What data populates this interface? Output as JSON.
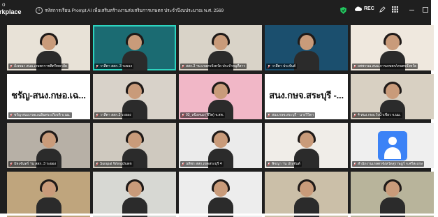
{
  "app": {
    "brand_top": "o",
    "brand_bottom": "rkplace"
  },
  "meeting": {
    "title": "รหัสการเรียน Prompt AI เพื่อเสริมสร้างงานส่งเสริมการเกษตร ประจำปีงบประมาณ พ.ศ. 2569"
  },
  "toolbar": {
    "rec_label": "REC",
    "icons": [
      "info-icon",
      "shield-icon",
      "cloud-icon",
      "pencil-icon",
      "grid-icon",
      "minimize-icon",
      "restore-icon"
    ],
    "shield_color": "#22c55e"
  },
  "tiles": [
    {
      "name": "อังคณา สนบ.เกษตรราชพิศวิทยาลัย",
      "kind": "video",
      "bg": "#e8e2d7"
    },
    {
      "name": "วาสีตา สสก. 3 ระยอง",
      "kind": "video",
      "bg": "#1b6b72"
    },
    {
      "name": "สสก.3 ฯน เกษตรจังหวัด ประจำหมูที่สาร",
      "kind": "video",
      "bg": "#d9d3c8"
    },
    {
      "name": "วาสีตา ประจันต์",
      "kind": "video",
      "bg": "#1b4f6e"
    },
    {
      "name": "ยศพรรณ สนบ.การเกษตร/เกษตรจังหวัด",
      "kind": "video",
      "bg": "#efe8de"
    },
    {
      "name": "ชรัญ-สนง.กษอ.เฉลิมพระเกียรติ จ.นม.",
      "kind": "text",
      "big": "ชรัญ-สนง.กษอ.เฉ...",
      "bg": "#ffffff"
    },
    {
      "name": "วาสีตา สสก.3 ระยอง",
      "kind": "video",
      "bg": "#d8d2c9"
    },
    {
      "name": "03_หนิงหนง (ชีวิต) จ.สต.",
      "kind": "video",
      "bg": "#f1b7c7"
    },
    {
      "name": "สนง.กษจ.สระบุรี - นางวิวิดา",
      "kind": "text",
      "big": "สนง.กษจ.สระบุรี -...",
      "bg": "#ffffff"
    },
    {
      "name": "4-สนง.กษอ.วังน้ำเขียว จ.นม.",
      "kind": "video",
      "bg": "#d8d0c2"
    },
    {
      "name": "บัหงจันทร์ ฯน สสก. 3 ระยอง",
      "kind": "video",
      "bg": "#b7b0a6"
    },
    {
      "name": "Surapat Wongchuen",
      "kind": "video",
      "bg": "#cfc9bf"
    },
    {
      "name": "นพิชร สสก.เขตสระบุรี 4",
      "kind": "video",
      "bg": "#ebebeb"
    },
    {
      "name": "พิชญา ฯน ประจันต์",
      "kind": "video",
      "bg": "#f0ede8"
    },
    {
      "name": "สำนักงานเกษตรจังหวัดสุราษฎร์ จ.ศรีสะเกษ",
      "kind": "avatar",
      "bg": "#efefef"
    },
    {
      "name": "",
      "kind": "video",
      "bg": "#bfa57d"
    },
    {
      "name": "",
      "kind": "video",
      "bg": "#d7d8d3"
    },
    {
      "name": "",
      "kind": "video",
      "bg": "#ededed"
    },
    {
      "name": "",
      "kind": "video",
      "bg": "#cbbfa8"
    },
    {
      "name": "",
      "kind": "video",
      "bg": "#b8b49b"
    }
  ]
}
